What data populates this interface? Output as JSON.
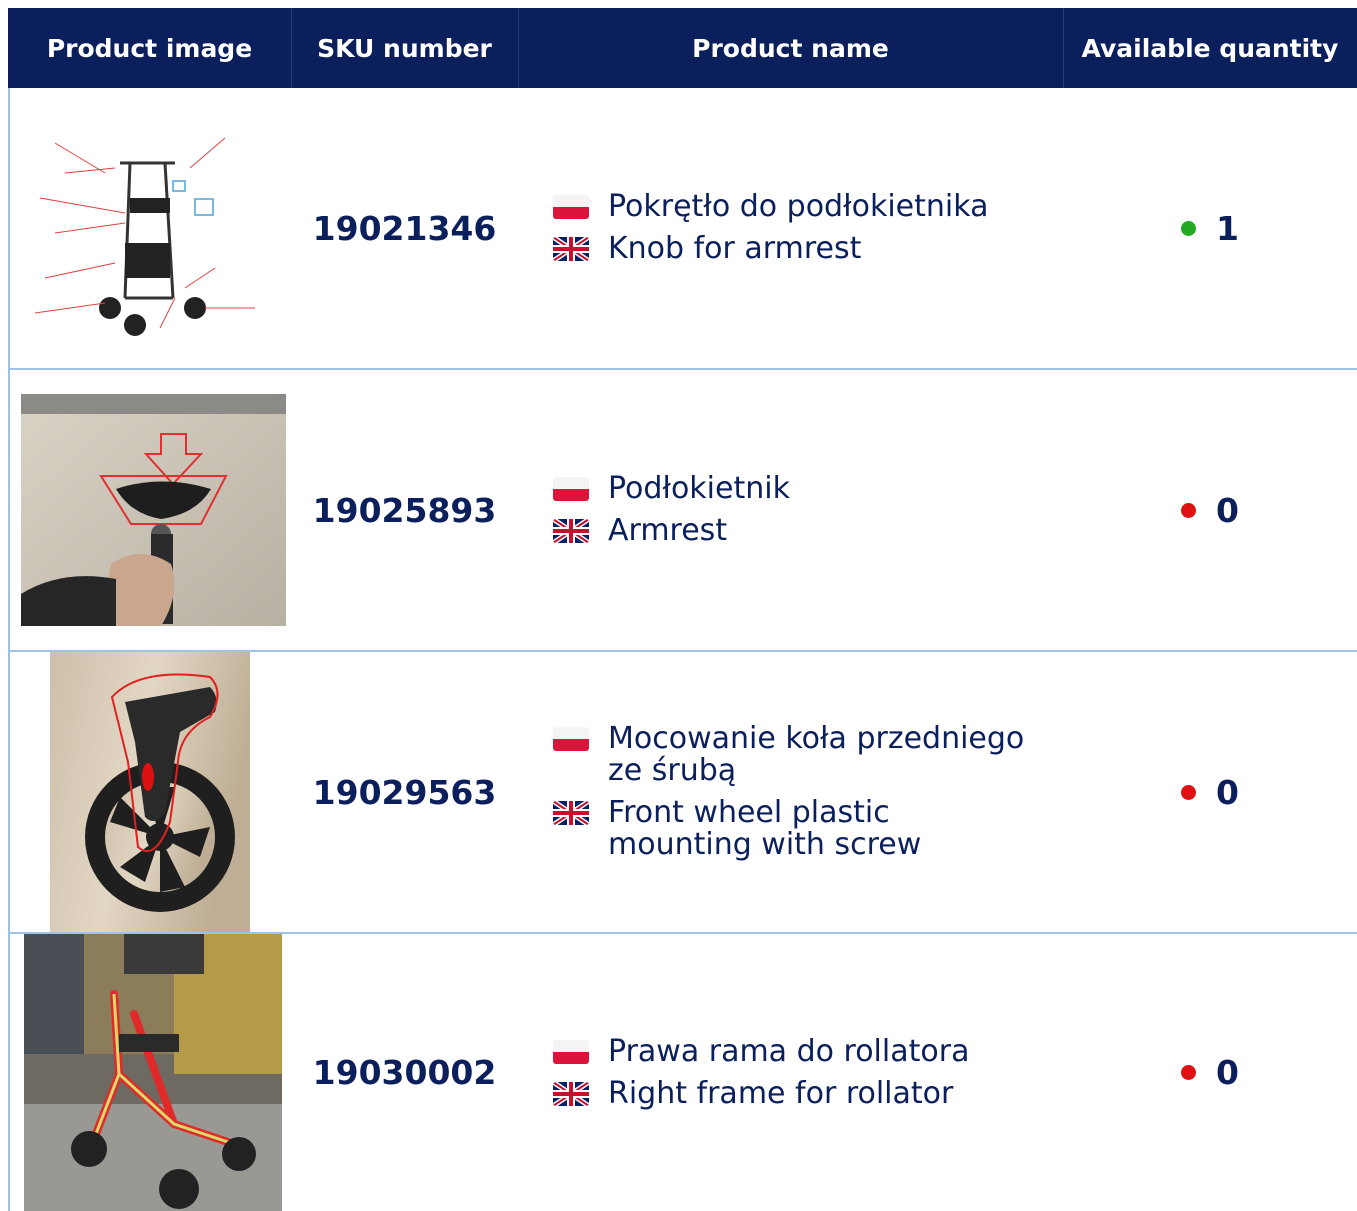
{
  "table": {
    "headers": {
      "image": "Product image",
      "sku": "SKU number",
      "name": "Product name",
      "qty": "Available quantity"
    },
    "rows": [
      {
        "sku": "19021346",
        "name_pl": "Pokrętło do podłokietnika",
        "name_en": "Knob for armrest",
        "qty": "1",
        "status": "available",
        "status_color": "#22aa22"
      },
      {
        "sku": "19025893",
        "name_pl": "Podłokietnik",
        "name_en": "Armrest",
        "qty": "0",
        "status": "out-of-stock",
        "status_color": "#dd1111"
      },
      {
        "sku": "19029563",
        "name_pl": "Mocowanie koła przedniego ze śrubą",
        "name_en": "Front wheel plastic mounting with screw",
        "qty": "0",
        "status": "out-of-stock",
        "status_color": "#dd1111"
      },
      {
        "sku": "19030002",
        "name_pl": "Prawa rama do rollatora",
        "name_en": "Right frame for rollator",
        "qty": "0",
        "status": "out-of-stock",
        "status_color": "#dd1111"
      }
    ]
  },
  "colors": {
    "header_bg": "#0a1f5c",
    "text": "#0a1f5c",
    "grid": "#9fc3e6"
  },
  "icons": {
    "flag_pl": "poland-flag-icon",
    "flag_en": "uk-flag-icon"
  }
}
